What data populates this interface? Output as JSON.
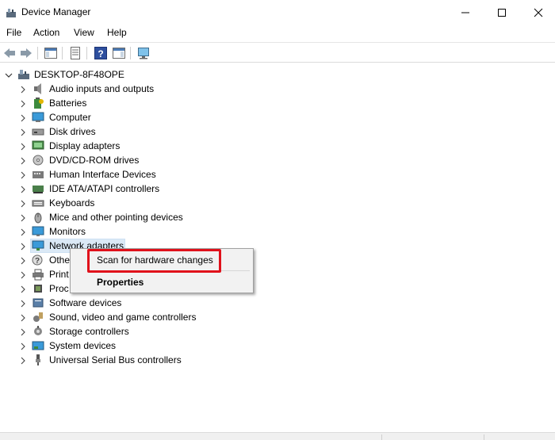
{
  "window": {
    "title": "Device Manager",
    "minimize_icon": "minimize-icon",
    "maximize_icon": "maximize-icon",
    "close_icon": "close-icon"
  },
  "menubar": {
    "items": [
      "File",
      "Action",
      "View",
      "Help"
    ]
  },
  "toolbar": {
    "buttons": [
      "back-arrow-icon",
      "forward-arrow-icon",
      "show-hide-console-tree-icon",
      "properties-icon",
      "help-icon",
      "action-pane-icon",
      "scan-hardware-monitor-icon"
    ]
  },
  "tree": {
    "root": "DESKTOP-8F48OPE",
    "items": [
      {
        "label": "Audio inputs and outputs",
        "icon": "speaker-icon"
      },
      {
        "label": "Batteries",
        "icon": "battery-icon"
      },
      {
        "label": "Computer",
        "icon": "computer-icon"
      },
      {
        "label": "Disk drives",
        "icon": "disk-drive-icon"
      },
      {
        "label": "Display adapters",
        "icon": "display-adapter-icon"
      },
      {
        "label": "DVD/CD-ROM drives",
        "icon": "dvd-drive-icon"
      },
      {
        "label": "Human Interface Devices",
        "icon": "hid-icon"
      },
      {
        "label": "IDE ATA/ATAPI controllers",
        "icon": "ide-controller-icon"
      },
      {
        "label": "Keyboards",
        "icon": "keyboard-icon"
      },
      {
        "label": "Mice and other pointing devices",
        "icon": "mouse-icon"
      },
      {
        "label": "Monitors",
        "icon": "monitor-icon"
      },
      {
        "label": "Network adapters",
        "icon": "network-adapter-icon",
        "selected": true
      },
      {
        "label": "Othe",
        "icon": "other-devices-icon"
      },
      {
        "label": "Print",
        "icon": "printer-icon"
      },
      {
        "label": "Proc",
        "icon": "processor-icon"
      },
      {
        "label": "Software devices",
        "icon": "software-device-icon"
      },
      {
        "label": "Sound, video and game controllers",
        "icon": "sound-controller-icon"
      },
      {
        "label": "Storage controllers",
        "icon": "storage-controller-icon"
      },
      {
        "label": "System devices",
        "icon": "system-device-icon"
      },
      {
        "label": "Universal Serial Bus controllers",
        "icon": "usb-icon"
      }
    ]
  },
  "context_menu": {
    "scan_label": "Scan for hardware changes",
    "properties_label": "Properties",
    "highlight_color": "#e0111b"
  }
}
